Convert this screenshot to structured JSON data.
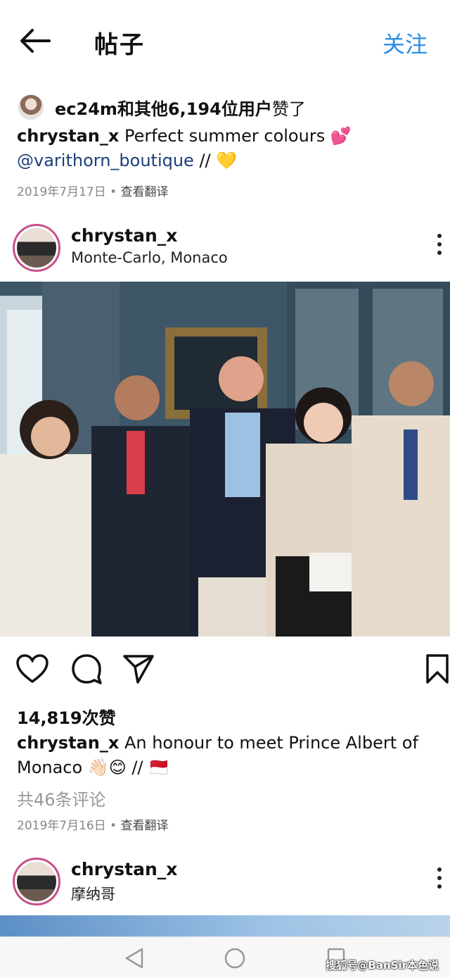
{
  "header": {
    "title": "帖子",
    "follow_label": "关注"
  },
  "post1": {
    "liked_by_user": "ec24m",
    "liked_by_rest": "和其他6,194位用户",
    "liked_suffix": "赞了",
    "caption_user": "chrystan_x",
    "caption_text": "Perfect summer colours 💕",
    "caption_mention": "@varithorn_boutique",
    "caption_tail": " // 💛",
    "date": "2019年7月17日",
    "translate_label": "查看翻译"
  },
  "post2": {
    "username": "chrystan_x",
    "location": "Monte-Carlo, Monaco",
    "likes_count": "14,819次赞",
    "caption_user": "chrystan_x",
    "caption_text": "An honour to meet Prince Albert of Monaco 👋🏻😊 // 🇲🇨",
    "comments_label": "共46条评论",
    "date": "2019年7月16日",
    "translate_label": "查看翻译"
  },
  "post3": {
    "username": "chrystan_x",
    "location": "摩纳哥"
  },
  "watermark": "搜狐号@BanSir本色说",
  "icons": [
    "back-arrow-icon",
    "heart-icon",
    "comment-icon",
    "share-icon",
    "bookmark-icon",
    "more-icon",
    "nav-back-icon",
    "nav-home-icon",
    "nav-recents-icon"
  ],
  "colors": {
    "accent": "#2a8ee6",
    "mention": "#1d3f7a",
    "meta": "#888888"
  }
}
